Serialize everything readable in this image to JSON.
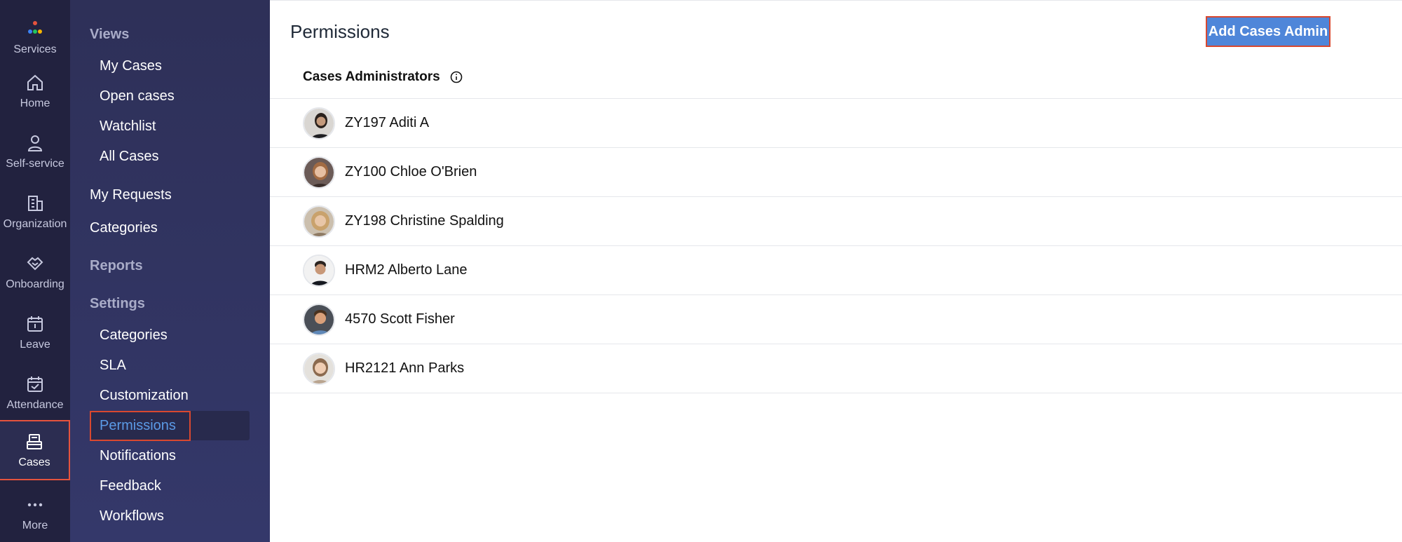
{
  "rail": {
    "items": [
      {
        "label": "Services",
        "icon": "services-dots-icon"
      },
      {
        "label": "Home",
        "icon": "home-icon"
      },
      {
        "label": "Self-service",
        "icon": "person-icon"
      },
      {
        "label": "Organization",
        "icon": "building-icon"
      },
      {
        "label": "Onboarding",
        "icon": "handshake-icon"
      },
      {
        "label": "Leave",
        "icon": "calendar-icon"
      },
      {
        "label": "Attendance",
        "icon": "calendar-check-icon"
      },
      {
        "label": "Cases",
        "icon": "cases-icon",
        "active": true
      },
      {
        "label": "More",
        "icon": "more-dots-icon"
      }
    ]
  },
  "subnav": {
    "views_heading": "Views",
    "views": [
      "My Cases",
      "Open cases",
      "Watchlist",
      "All Cases"
    ],
    "my_requests": "My Requests",
    "categories": "Categories",
    "reports": "Reports",
    "settings_heading": "Settings",
    "settings": [
      "Categories",
      "SLA",
      "Customization",
      "Permissions",
      "Notifications",
      "Feedback",
      "Workflows"
    ],
    "active_item": "Permissions"
  },
  "main": {
    "title": "Permissions",
    "add_button": "Add Cases Admin",
    "section_title": "Cases Administrators",
    "admins": [
      {
        "name": "ZY197 Aditi A"
      },
      {
        "name": "ZY100 Chloe O'Brien"
      },
      {
        "name": "ZY198 Christine Spalding"
      },
      {
        "name": "HRM2 Alberto Lane"
      },
      {
        "name": "4570 Scott Fisher"
      },
      {
        "name": "HR2121 Ann Parks"
      }
    ]
  },
  "colors": {
    "rail_bg": "#22223f",
    "subnav_bg": "#2e3058",
    "accent": "#4f86d9",
    "highlight_border": "#d9482f",
    "active_link": "#5b9ae6"
  }
}
